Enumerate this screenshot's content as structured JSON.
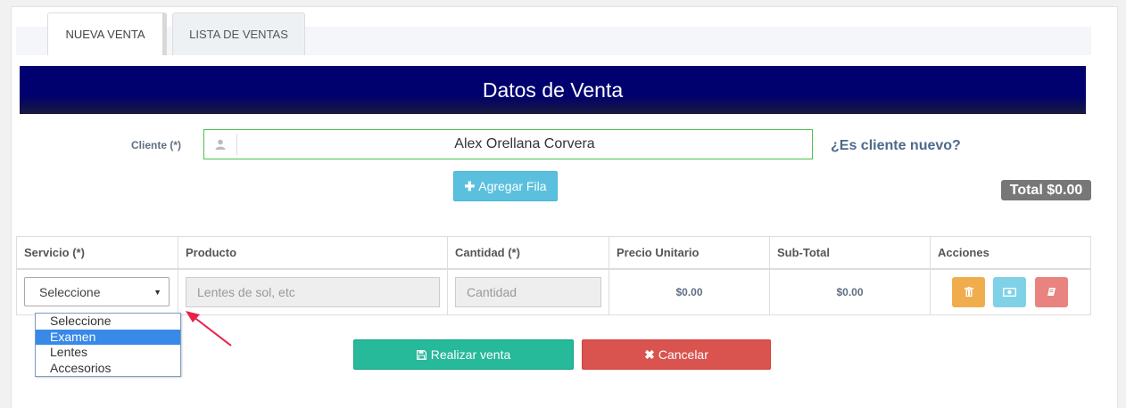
{
  "tabs": [
    {
      "label": "NUEVA VENTA",
      "active": true
    },
    {
      "label": "LISTA DE VENTAS",
      "active": false
    }
  ],
  "banner": {
    "title": "Datos de Venta"
  },
  "cliente": {
    "label": "Cliente (*)",
    "icon": "user-icon",
    "value": "Alex  Orellana Corvera",
    "new_link": "¿Es cliente nuevo?"
  },
  "add_row": {
    "label": "Agregar Fila",
    "icon": "plus-icon"
  },
  "total": {
    "label": "Total $0.00"
  },
  "table": {
    "headers": [
      "Servicio (*)",
      "Producto",
      "Cantidad (*)",
      "Precio Unitario",
      "Sub-Total",
      "Acciones"
    ],
    "row": {
      "servicio_selected": "Seleccione",
      "producto_placeholder": "Lentes de sol, etc",
      "cantidad_placeholder": "Cantidad",
      "precio": "$0.00",
      "subtotal": "$0.00"
    }
  },
  "dropdown_options": [
    "Seleccione",
    "Examen",
    "Lentes",
    "Accesorios"
  ],
  "dropdown_highlighted": 1,
  "actions": {
    "submit": {
      "label": "Realizar venta",
      "icon": "save-icon"
    },
    "cancel": {
      "label": "Cancelar",
      "icon": "times-icon"
    }
  },
  "colors": {
    "banner": "#00006e",
    "success": "#26b99a",
    "danger": "#d9534f",
    "warning": "#f0ad4e",
    "info": "#5bc0de",
    "annotation_arrow": "#e8204a"
  }
}
